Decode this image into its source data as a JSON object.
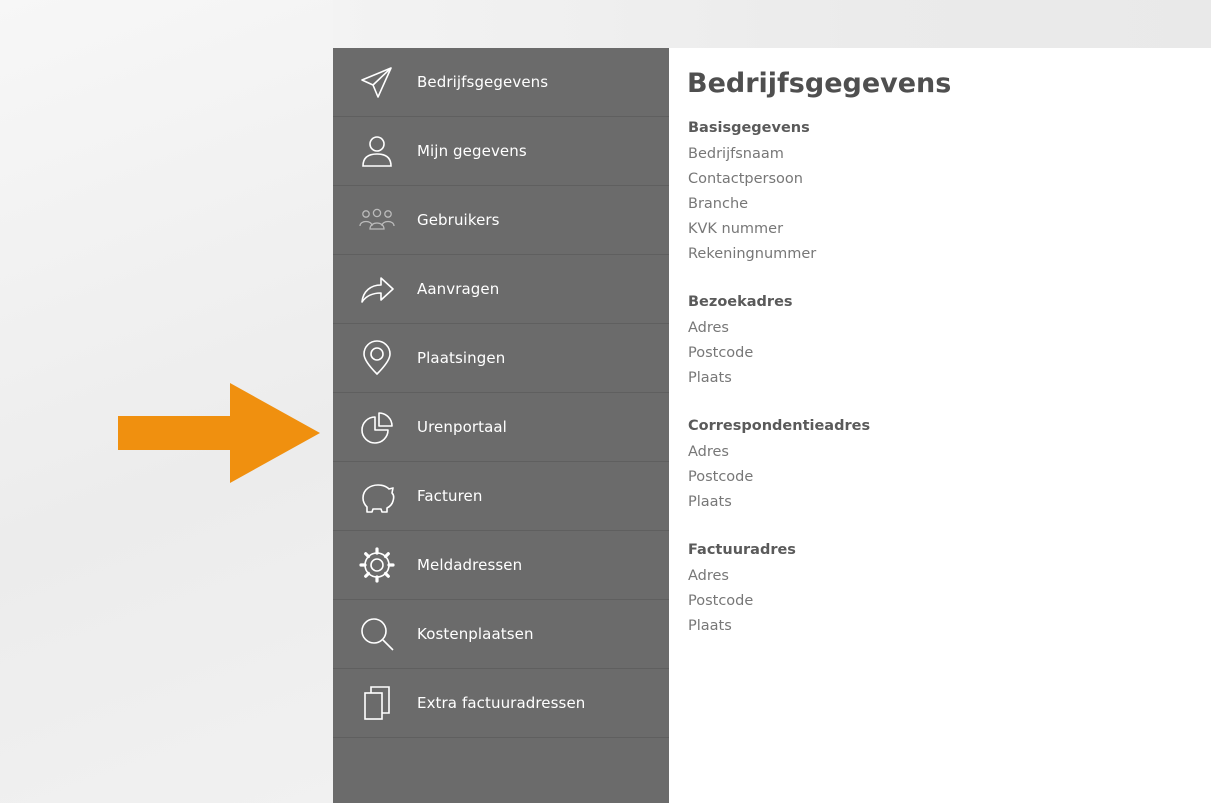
{
  "sidebar": {
    "items": [
      {
        "label": "Bedrijfsgegevens",
        "icon": "paper-plane-icon"
      },
      {
        "label": "Mijn gegevens",
        "icon": "user-icon"
      },
      {
        "label": "Gebruikers",
        "icon": "users-icon"
      },
      {
        "label": "Aanvragen",
        "icon": "share-arrow-icon"
      },
      {
        "label": "Plaatsingen",
        "icon": "map-pin-icon"
      },
      {
        "label": "Urenportaal",
        "icon": "pie-chart-icon"
      },
      {
        "label": "Facturen",
        "icon": "piggy-bank-icon"
      },
      {
        "label": "Meldadressen",
        "icon": "gear-icon"
      },
      {
        "label": "Kostenplaatsen",
        "icon": "search-icon"
      },
      {
        "label": "Extra factuuradressen",
        "icon": "copy-icon"
      }
    ]
  },
  "main": {
    "title": "Bedrijfsgegevens",
    "sections": [
      {
        "title": "Basisgegevens",
        "fields": [
          "Bedrijfsnaam",
          "Contactpersoon",
          "Branche",
          "KVK nummer",
          "Rekeningnummer"
        ]
      },
      {
        "title": "Bezoekadres",
        "fields": [
          "Adres",
          "Postcode",
          "Plaats"
        ]
      },
      {
        "title": "Correspondentieadres",
        "fields": [
          "Adres",
          "Postcode",
          "Plaats"
        ]
      },
      {
        "title": "Factuuradres",
        "fields": [
          "Adres",
          "Postcode",
          "Plaats"
        ]
      }
    ]
  },
  "colors": {
    "sidebar_bg": "#6b6b6b",
    "arrow": "#f0900f",
    "title_text": "#4f4f4f"
  }
}
